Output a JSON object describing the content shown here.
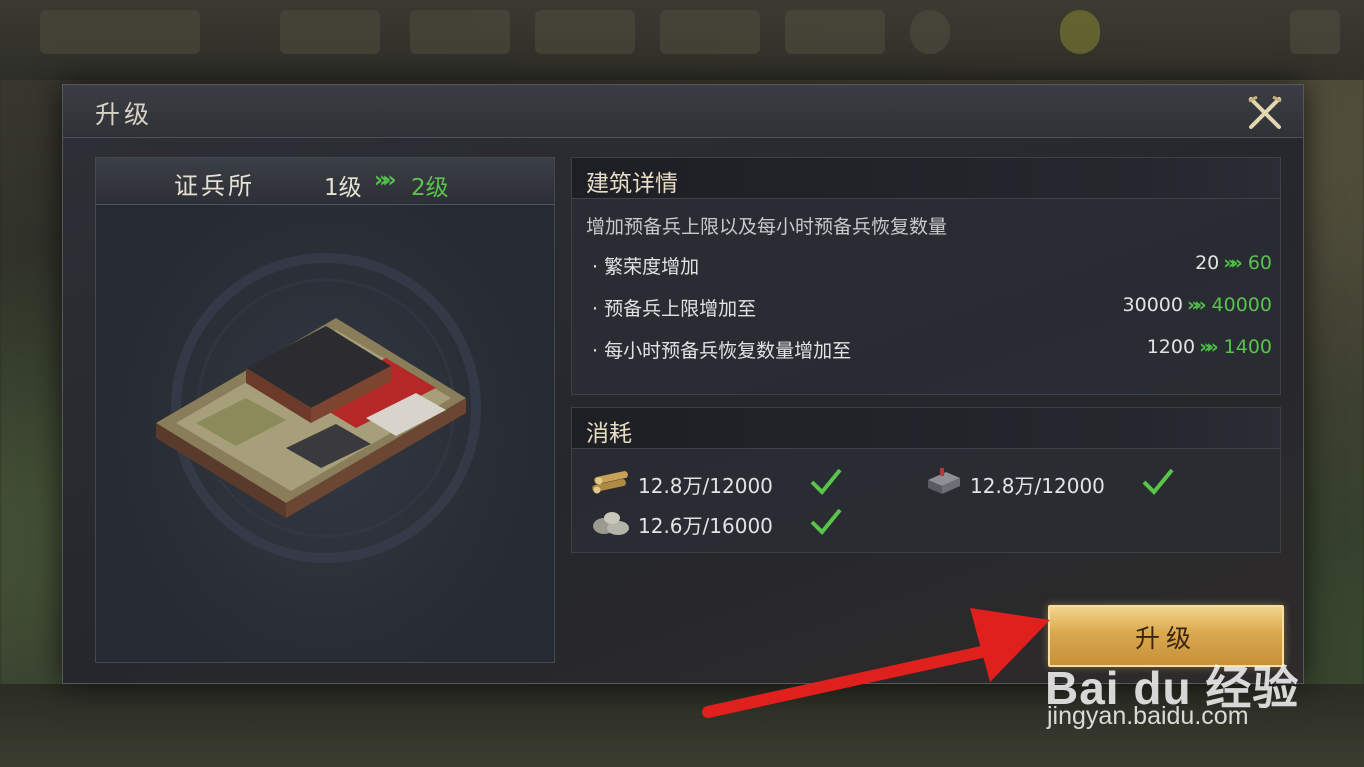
{
  "dialog": {
    "title": "升级",
    "close_icon": "close-crossed-swords-icon"
  },
  "building": {
    "name": "证兵所",
    "level_from": "1级",
    "level_arrow": "»",
    "level_to": "2级"
  },
  "details": {
    "title": "建筑详情",
    "description": "增加预备兵上限以及每小时预备兵恢复数量",
    "rows": [
      {
        "label": "繁荣度增加",
        "from": "20",
        "to": "60"
      },
      {
        "label": "预备兵上限增加至",
        "from": "30000",
        "to": "40000"
      },
      {
        "label": "每小时预备兵恢复数量增加至",
        "from": "1200",
        "to": "1400"
      }
    ],
    "bullet": "·",
    "arrow": "»"
  },
  "cost": {
    "title": "消耗",
    "items": [
      {
        "icon": "wood-icon",
        "amount": "12.8万/12000",
        "satisfied": true
      },
      {
        "icon": "iron-icon",
        "amount": "12.8万/12000",
        "satisfied": true
      },
      {
        "icon": "stone-icon",
        "amount": "12.6万/16000",
        "satisfied": true
      }
    ]
  },
  "upgrade_button": {
    "label": "升级"
  },
  "watermark": {
    "brand": "Bai du 经验",
    "url": "jingyan.baidu.com"
  },
  "colors": {
    "accent_green": "#5ac24e",
    "button_gold": "#d9a84f",
    "arrow_red": "#e0201c"
  }
}
